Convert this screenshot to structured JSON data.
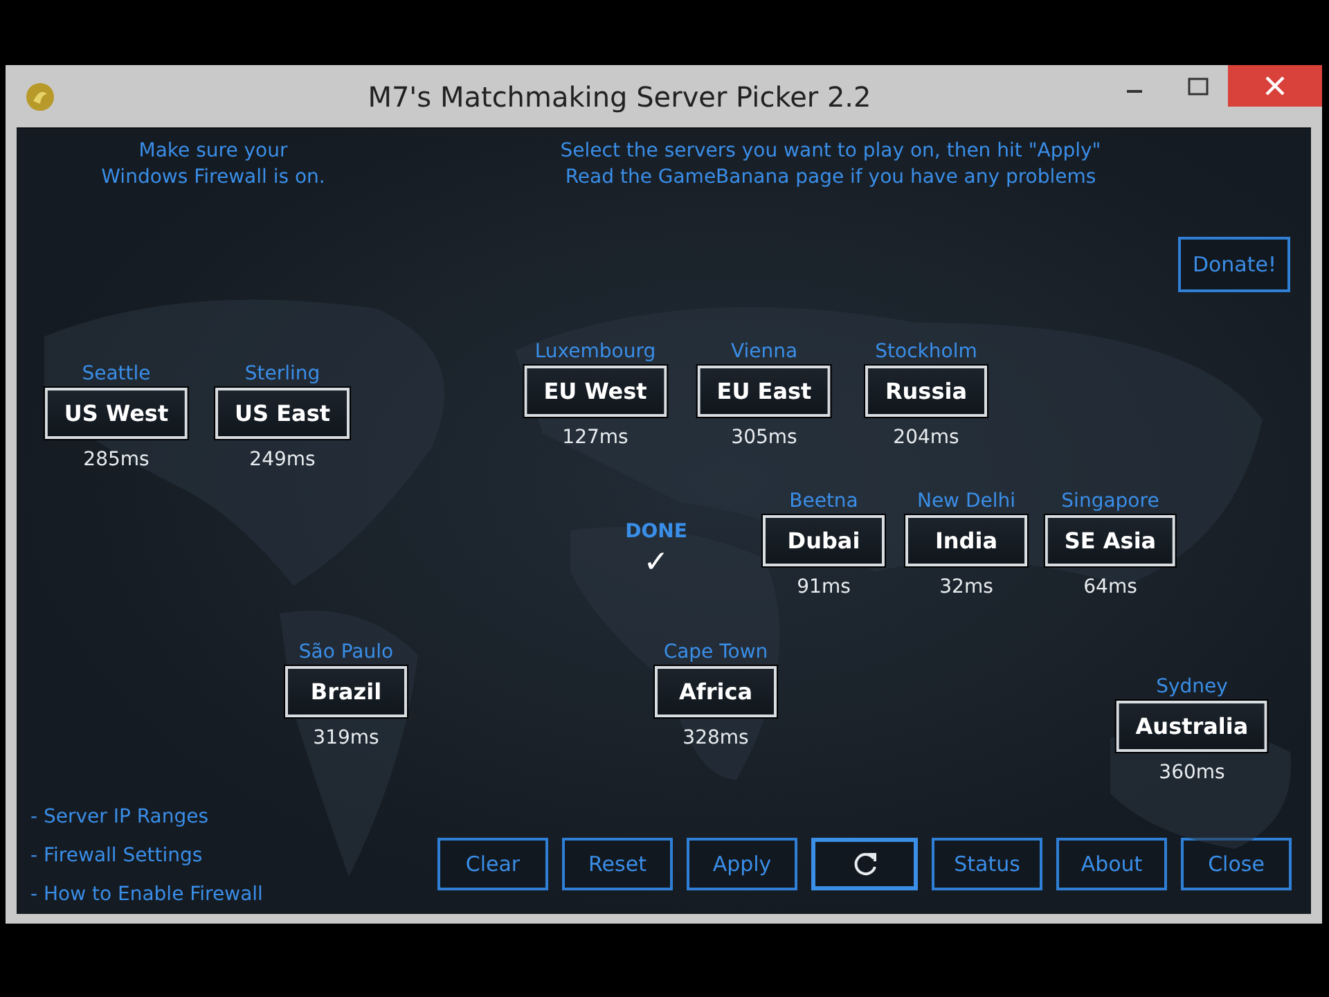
{
  "window": {
    "title": "M7's Matchmaking Server Picker 2.2"
  },
  "notice_left": [
    "Make sure your",
    "Windows Firewall is on."
  ],
  "notice_right": [
    "Select the servers you want to play on, then hit \"Apply\"",
    "Read the GameBanana page if you have any problems"
  ],
  "donate_button": "Donate!",
  "servers": [
    {
      "city": "Seattle",
      "region": "US West",
      "ping": "285ms"
    },
    {
      "city": "Sterling",
      "region": "US East",
      "ping": "249ms"
    },
    {
      "city": "Luxembourg",
      "region": "EU West",
      "ping": "127ms"
    },
    {
      "city": "Vienna",
      "region": "EU East",
      "ping": "305ms"
    },
    {
      "city": "Stockholm",
      "region": "Russia",
      "ping": "204ms"
    },
    {
      "city": "Beetna",
      "region": "Dubai",
      "ping": "91ms"
    },
    {
      "city": "New Delhi",
      "region": "India",
      "ping": "32ms"
    },
    {
      "city": "Singapore",
      "region": "SE Asia",
      "ping": "64ms"
    },
    {
      "city": "São Paulo",
      "region": "Brazil",
      "ping": "319ms"
    },
    {
      "city": "Cape Town",
      "region": "Africa",
      "ping": "328ms"
    },
    {
      "city": "Sydney",
      "region": "Australia",
      "ping": "360ms"
    }
  ],
  "status": {
    "label": "DONE",
    "mark": "✓"
  },
  "links": [
    "- Server IP Ranges",
    "- Firewall Settings",
    "- How to Enable Firewall"
  ],
  "buttons": [
    {
      "kind": "text",
      "label": "Clear"
    },
    {
      "kind": "text",
      "label": "Reset"
    },
    {
      "kind": "text",
      "label": "Apply"
    },
    {
      "kind": "refresh"
    },
    {
      "kind": "text",
      "label": "Status"
    },
    {
      "kind": "text",
      "label": "About"
    },
    {
      "kind": "text",
      "label": "Close"
    }
  ]
}
